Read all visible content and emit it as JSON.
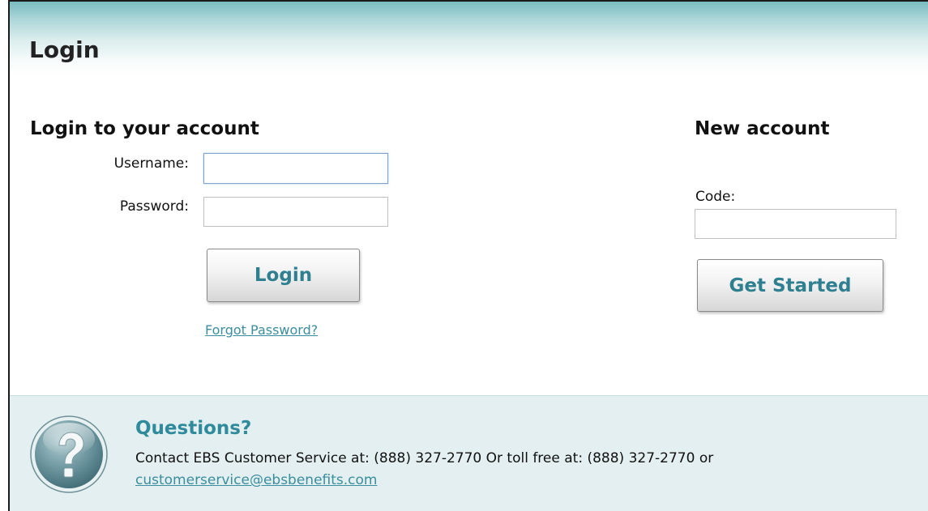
{
  "header": {
    "title": "Login"
  },
  "login_section": {
    "title": "Login to your account",
    "username_label": "Username:",
    "username_value": "",
    "password_label": "Password:",
    "password_value": "",
    "login_button": "Login",
    "forgot_link": "Forgot Password?"
  },
  "new_account": {
    "title": "New account",
    "code_label": "Code:",
    "code_value": "",
    "get_started_button": "Get Started"
  },
  "footer": {
    "questions_title": "Questions?",
    "contact_text": "Contact EBS Customer Service at: (888) 327-2770 Or toll free at: (888) 327-2770 or",
    "email": "customerservice@ebsbenefits.com",
    "icon": "question-mark-icon"
  },
  "colors": {
    "accent": "#2f8a9b",
    "link": "#3b8e9d",
    "header_gradient_top": "#79bcc0",
    "footer_background": "#e3eff0"
  }
}
